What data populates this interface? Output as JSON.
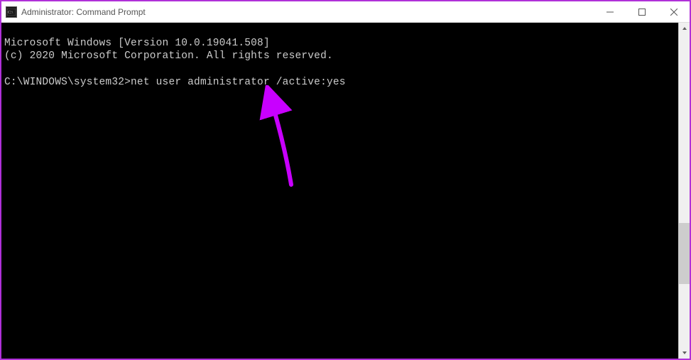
{
  "window": {
    "title": "Administrator: Command Prompt",
    "icon_label": "cmd-icon"
  },
  "terminal": {
    "line1": "Microsoft Windows [Version 10.0.19041.508]",
    "line2": "(c) 2020 Microsoft Corporation. All rights reserved.",
    "blank": "",
    "prompt": "C:\\WINDOWS\\system32>",
    "command": "net user administrator /active:yes"
  },
  "annotation": {
    "color": "#c800ff"
  }
}
